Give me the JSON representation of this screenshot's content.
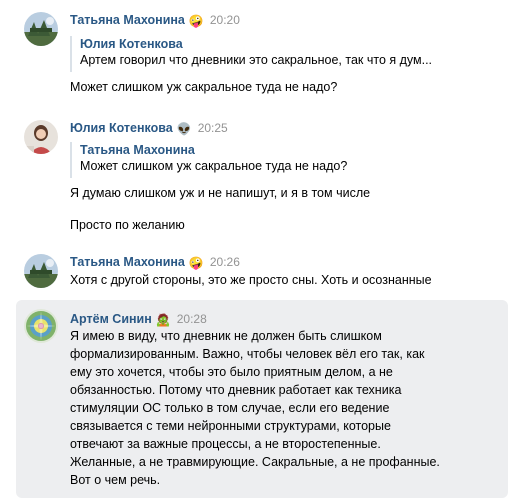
{
  "messages": [
    {
      "author": "Татьяна Махонина",
      "time": "20:20",
      "reaction": "🤪",
      "quote": {
        "author": "Юлия Котенкова",
        "text": "Артем говорил что дневники это сакральное, так что я дум..."
      },
      "text": "Может слишком уж сакральное туда не надо?"
    },
    {
      "author": "Юлия Котенкова",
      "time": "20:25",
      "reaction": "👽",
      "quote": {
        "author": "Татьяна Махонина",
        "text": "Может слишком уж сакральное туда не надо?"
      },
      "text": "Я думаю слишком уж и не напишут, и я в том числе",
      "text2": "Просто по желанию"
    },
    {
      "author": "Татьяна Махонина",
      "time": "20:26",
      "reaction": "🤪",
      "text": "Хотя с другой стороны, это же просто сны. Хоть и осознанные"
    },
    {
      "author": "Артём Синин",
      "time": "20:28",
      "reaction": "🧟",
      "lines": [
        "Я имею в виду, что дневник не должен быть слишком",
        "формализированным. Важно, чтобы человек вёл его так, как",
        "ему это хочется, чтобы это было приятным делом, а не",
        "обязанностью. Потому что дневник работает как техника",
        "стимуляции ОС только в том случае, если его ведение",
        "связывается с теми нейронными структурами, которые",
        "отвечают за важные процессы, а не второстепенные.",
        "Желанные, а не травмирующие. Сакральные, а не профанные.",
        "Вот о чем речь."
      ]
    }
  ],
  "colors": {
    "name": "#2a5885",
    "time": "#939393",
    "highlight": "#edeef0",
    "quote_bar": "#dae1e8"
  }
}
